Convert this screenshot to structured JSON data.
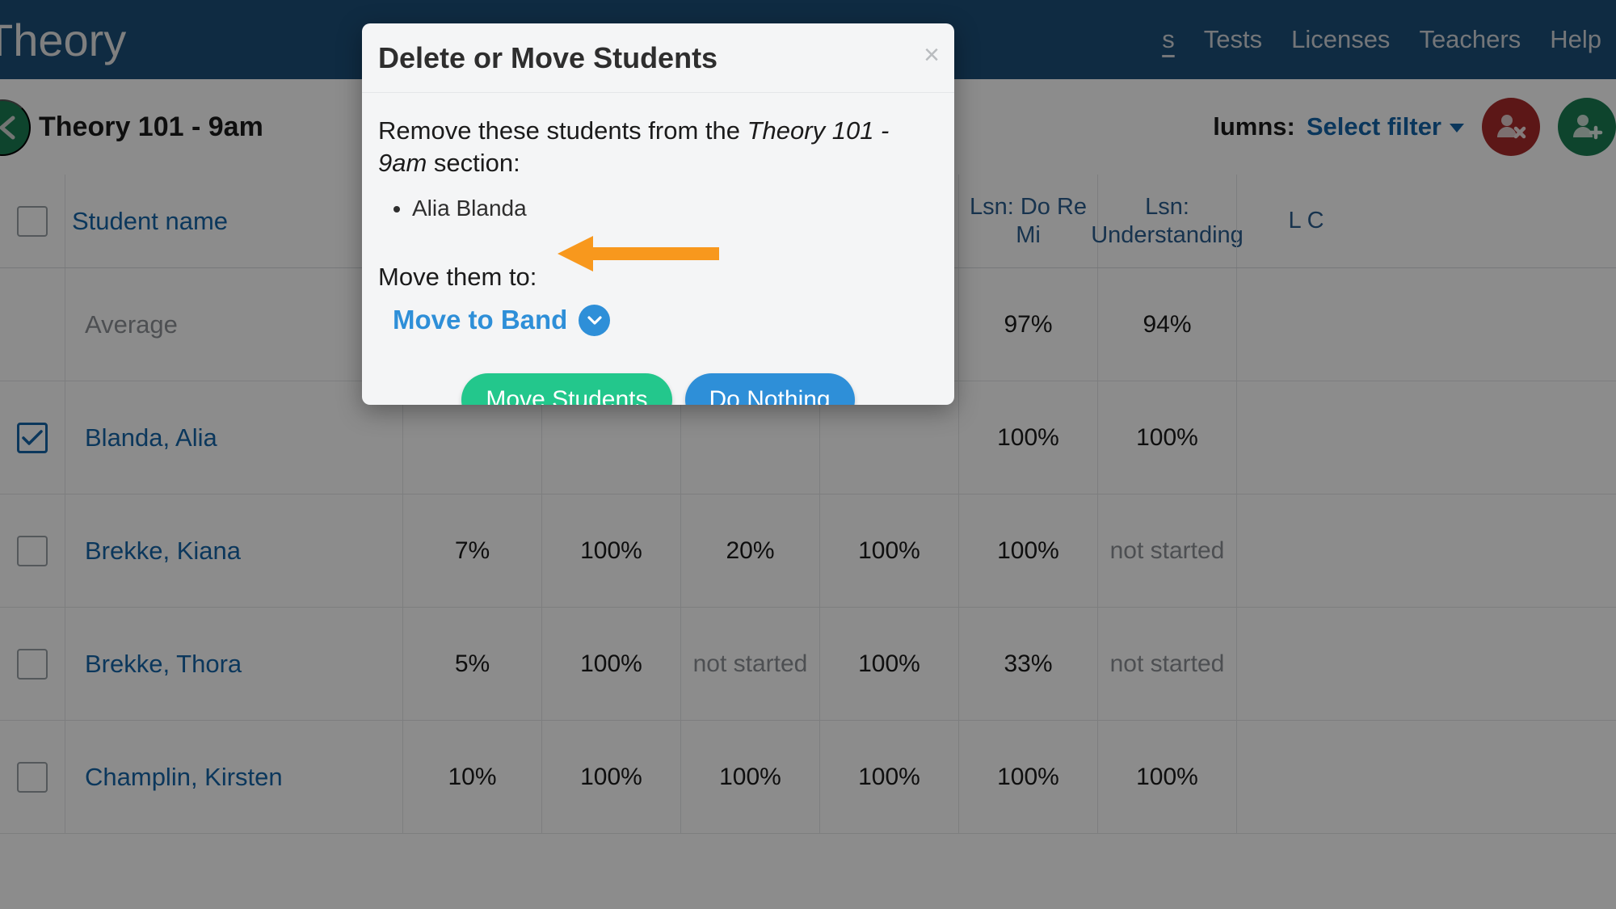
{
  "app": {
    "brand": "Theory",
    "nav_links": [
      {
        "label": "s",
        "active": true
      },
      {
        "label": "Tests",
        "active": false
      },
      {
        "label": "Licenses",
        "active": false
      },
      {
        "label": "Teachers",
        "active": false
      },
      {
        "label": "Help",
        "active": false
      }
    ]
  },
  "toolbar": {
    "section_title": "Theory 101 - 9am",
    "columns_label": "lumns:",
    "select_filter_label": "Select filter",
    "back_icon": "chevron-left-icon",
    "remove_student_icon": "person-remove-icon",
    "add_student_icon": "person-add-icon"
  },
  "table": {
    "headers": {
      "student_name": "Student name",
      "col_a": "",
      "col_b": "",
      "col_c": "",
      "col_d": "",
      "lsn_do_re_mi": "Lsn: Do Re Mi",
      "lsn_understanding": "Lsn: Understanding",
      "lsn_partial": "L  C"
    },
    "rows": [
      {
        "checked": false,
        "name": "Average",
        "is_average": true,
        "values": [
          "",
          "",
          "",
          "",
          "97%",
          "94%",
          ""
        ]
      },
      {
        "checked": true,
        "name": "Blanda, Alia",
        "is_average": false,
        "values": [
          "",
          "",
          "",
          "",
          "100%",
          "100%",
          ""
        ]
      },
      {
        "checked": false,
        "name": "Brekke, Kiana",
        "is_average": false,
        "values": [
          "7%",
          "100%",
          "20%",
          "100%",
          "100%",
          "not started",
          ""
        ]
      },
      {
        "checked": false,
        "name": "Brekke, Thora",
        "is_average": false,
        "values": [
          "5%",
          "100%",
          "not started",
          "100%",
          "33%",
          "not started",
          ""
        ]
      },
      {
        "checked": false,
        "name": "Champlin, Kirsten",
        "is_average": false,
        "values": [
          "10%",
          "100%",
          "100%",
          "100%",
          "100%",
          "100%",
          ""
        ]
      }
    ]
  },
  "modal": {
    "title": "Delete or Move Students",
    "close_label": "×",
    "remove_prefix": "Remove these students from the ",
    "remove_section": "Theory 101 - 9am",
    "remove_suffix": " section:",
    "students": [
      "Alia Blanda"
    ],
    "move_label": "Move them to:",
    "dropdown_label": "Move to Band",
    "dropdown_icon": "chevron-down-icon",
    "primary_button": "Move Students",
    "secondary_button": "Do Nothing"
  },
  "annotation": {
    "arrow_icon": "left-arrow-annotation",
    "color": "#f8981d"
  },
  "colors": {
    "nav_bar": "#1c4f78",
    "accent_blue": "#2e8fd8",
    "link_blue": "#1565a8",
    "green": "#23c78c",
    "danger_red": "#a82a2a",
    "success_green": "#1a7d52",
    "arrow_orange": "#f8981d"
  }
}
